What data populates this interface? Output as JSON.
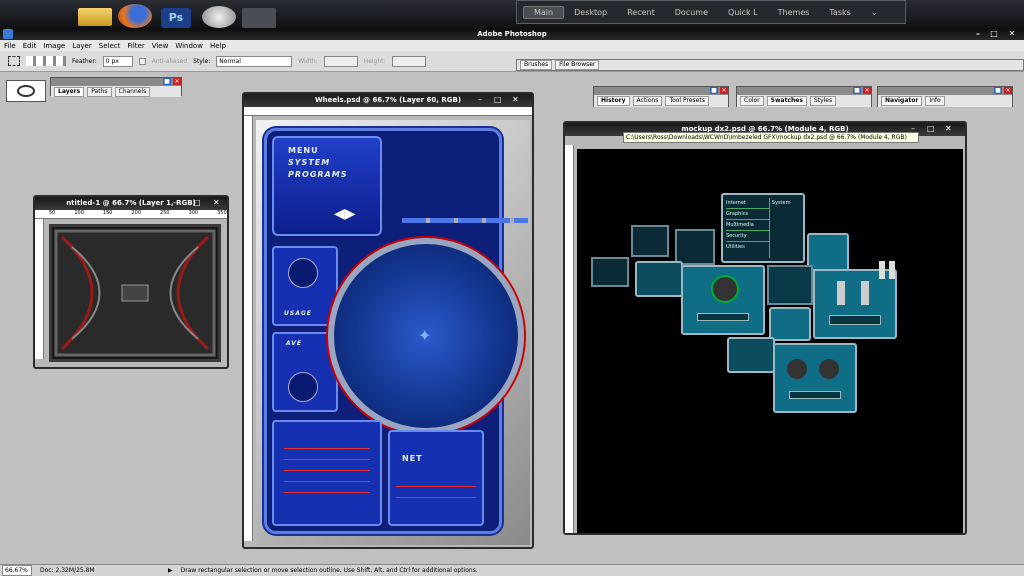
{
  "taskbar": {
    "menu": [
      "Main",
      "Desktop",
      "Recent",
      "Docume",
      "Quick L",
      "Themes",
      "Tasks"
    ],
    "active": "Main",
    "icons": [
      "folder-icon",
      "firefox-icon",
      "photoshop-icon",
      "globe-icon",
      "blank-icon"
    ]
  },
  "app": {
    "title": "Adobe Photoshop"
  },
  "menubar": [
    "File",
    "Edit",
    "Image",
    "Layer",
    "Select",
    "Filter",
    "View",
    "Window",
    "Help"
  ],
  "options": {
    "feather_label": "Feather:",
    "feather_value": "0 px",
    "antialias_label": "Anti-aliased",
    "style_label": "Style:",
    "style_value": "Normal",
    "width_label": "Width:",
    "height_label": "Height:"
  },
  "wells": [
    "Brushes",
    "File Browser"
  ],
  "palettes": {
    "layers": [
      "Layers",
      "Paths",
      "Channels"
    ],
    "history": [
      "History",
      "Actions",
      "Tool Presets"
    ],
    "swatches": [
      "Color",
      "Swatches",
      "Styles"
    ],
    "navigator": [
      "Navigator",
      "Info"
    ]
  },
  "docs": {
    "untitled": {
      "title": "ntitled-1 @ 66.7% (Layer 1, RGB)",
      "ticks": [
        "50",
        "100",
        "150",
        "200",
        "250",
        "300",
        "350"
      ]
    },
    "wheels": {
      "title": "Wheels.psd @ 66.7% (Layer 60, RGB)",
      "menu": [
        "MENU",
        "SYSTEM",
        "PROGRAMS"
      ],
      "usage": "USAGE",
      "ave": "AVE",
      "net": "NET"
    },
    "mockup": {
      "title": "mockup dx2.psd @ 66.7% (Module 4, RGB)",
      "tooltip": "C:\\Users\\Ross\\Downloads\\WCWnD\\Imbezeled GFX\\mockup dx2.psd @ 66.7% (Module 4, RGB)",
      "list_left": [
        "Internet",
        "Graphics",
        "Multimedia",
        "Security",
        "Utilities"
      ],
      "list_right": [
        "System"
      ]
    }
  },
  "status": {
    "zoom": "66.67%",
    "doc": "Doc: 2.32M/25.8M",
    "hint": "Draw rectangular selection or move selection outline. Use Shift, Alt, and Ctrl for additional options."
  }
}
